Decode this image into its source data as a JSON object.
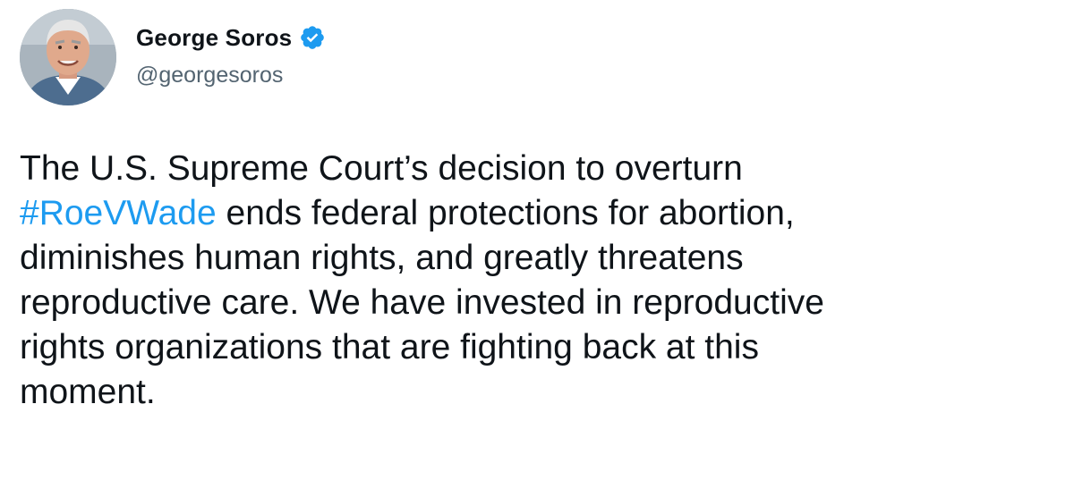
{
  "tweet": {
    "author": {
      "display_name": "George Soros",
      "handle": "@georgesoros",
      "verified_icon": "verified-badge-icon",
      "avatar_icon": "profile-photo"
    },
    "text": {
      "line1": "The U.S. Supreme Court’s decision to overturn",
      "line2_hashtag": "#RoeVWade",
      "line2_rest": " ends federal protections for abortion,",
      "line3": "diminishes human rights, and greatly threatens",
      "line4": "reproductive care. We have invested in reproductive",
      "line5": "rights organizations that are fighting back at this",
      "line6": "moment."
    }
  },
  "colors": {
    "text": "#0f1419",
    "secondary": "#536471",
    "accent": "#1d9bf0",
    "background": "#ffffff"
  }
}
